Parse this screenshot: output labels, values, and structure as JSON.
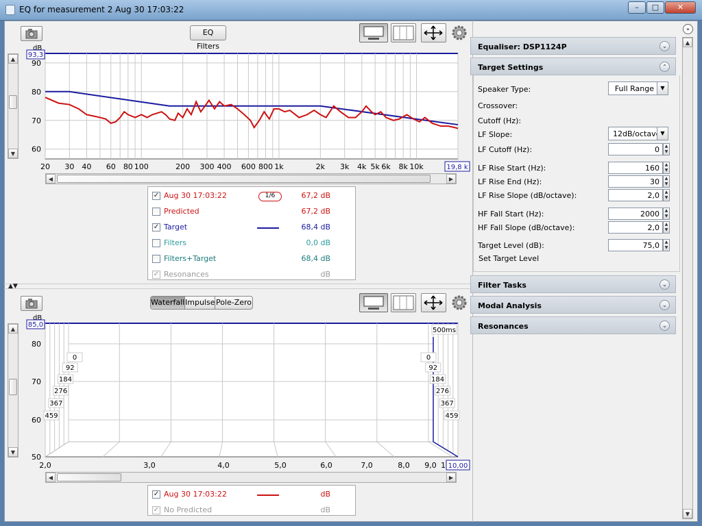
{
  "window": {
    "title": "EQ for measurement 2 Aug 30 17:03:22",
    "min": "–",
    "max": "□",
    "close": "✕"
  },
  "top_graph": {
    "eq_filters_label": "EQ Filters",
    "y_unit": "dB",
    "y_top_box": "93,3",
    "y_ticks": [
      "90",
      "80",
      "70",
      "60"
    ],
    "x_ticks": [
      "20",
      "30",
      "40",
      "60",
      "80",
      "100",
      "200",
      "300",
      "400",
      "600",
      "800",
      "1k",
      "2k",
      "3k",
      "4k",
      "5k",
      "6k",
      "8k",
      "10k",
      "2"
    ],
    "x_right_box": "19,8 k",
    "legend": [
      {
        "checked": true,
        "label": "Aug 30 17:03:22",
        "value": "67,2 dB",
        "color": "#cc1111",
        "swatch": "1/6"
      },
      {
        "checked": false,
        "label": "Predicted",
        "value": "67,2 dB",
        "color": "#cc1111"
      },
      {
        "checked": true,
        "label": "Target",
        "value": "68,4 dB",
        "color": "#1a1aa0",
        "swatch": "line"
      },
      {
        "checked": false,
        "label": "Filters",
        "value": "0,0 dB",
        "color": "#2a9a9a"
      },
      {
        "checked": false,
        "label": "Filters+Target",
        "value": "68,4 dB",
        "color": "#1a7a7a"
      },
      {
        "checked": true,
        "label": "Resonances",
        "value": "dB",
        "color": "#999999",
        "disabled": true
      }
    ]
  },
  "bottom_graph": {
    "tabs": [
      "Waterfall",
      "Impulse",
      "Pole-Zero"
    ],
    "active_tab": "Waterfall",
    "y_unit": "dB",
    "y_top_box": "85,0",
    "y_ticks": [
      "80",
      "70",
      "60",
      "50"
    ],
    "x_ticks": [
      "2,0",
      "3,0",
      "4,0",
      "5,0",
      "6,0",
      "7,0",
      "8,0",
      "9,0",
      "10"
    ],
    "x_right_box": "10,00",
    "time_label": "500ms",
    "depth_labels": [
      "0",
      "92",
      "184",
      "276",
      "367",
      "459"
    ],
    "legend": [
      {
        "checked": true,
        "label": "Aug 30 17:03:22",
        "value": "dB",
        "color": "#cc1111",
        "swatch": "line"
      },
      {
        "checked": true,
        "label": "No Predicted",
        "value": "dB",
        "color": "#999999",
        "disabled": true
      }
    ]
  },
  "right_panel": {
    "equaliser": "Equaliser: DSP1124P",
    "target_settings": "Target Settings",
    "fields": [
      {
        "label": "Speaker Type:",
        "type": "combo",
        "value": "Full Range"
      },
      {
        "label": "Crossover:",
        "type": "none"
      },
      {
        "label": "Cutoff (Hz):",
        "type": "none"
      },
      {
        "label": "LF Slope:",
        "type": "combo",
        "value": "12dB/octave"
      },
      {
        "label": "LF Cutoff (Hz):",
        "type": "spin",
        "value": "0"
      },
      {
        "label": "LF Rise Start (Hz):",
        "type": "spin",
        "value": "160"
      },
      {
        "label": "LF Rise End (Hz):",
        "type": "spin",
        "value": "30"
      },
      {
        "label": "LF Rise Slope (dB/octave):",
        "type": "spin",
        "value": "2,0"
      },
      {
        "label": "HF Fall Start (Hz):",
        "type": "spin",
        "value": "2000"
      },
      {
        "label": "HF Fall Slope (dB/octave):",
        "type": "spin",
        "value": "2,0"
      },
      {
        "label": "Target Level (dB):",
        "type": "spin",
        "value": "75,0"
      }
    ],
    "set_target_level": "Set Target Level",
    "sections": [
      "Filter Tasks",
      "Modal Analysis",
      "Resonances"
    ]
  }
}
